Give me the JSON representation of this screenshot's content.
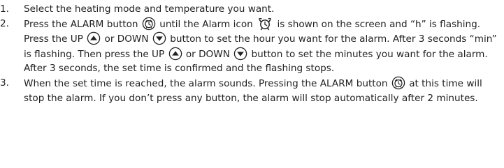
{
  "steps": [
    {
      "number": "1.",
      "text": "Select the heating mode and temperature you want."
    },
    {
      "number": "2.",
      "t1": "Press the ALARM button",
      "t2": "until the Alarm icon",
      "t3": "is shown on the screen and “h” is flashing. Press the UP",
      "t4": "or DOWN",
      "t5": "button to set the hour you want for the alarm. After 3 seconds “min” is flashing. Then press the UP",
      "t6": "or DOWN",
      "t7": "button to set the minutes you want for the alarm. After 3 seconds, the set time is confirmed and the flashing stops."
    },
    {
      "number": "3.",
      "t1": "When the set time is reached, the alarm sounds. Pressing the ALARM button",
      "t2": "at this time will stop the alarm. If you don’t press any button, the alarm will stop automatically after 2 minutes."
    }
  ],
  "icons": {
    "alarm_button": "alarm-button-icon",
    "alarm_screen": "alarm-clock-icon",
    "up_button": "up-arrow-button-icon",
    "down_button": "down-arrow-button-icon"
  }
}
